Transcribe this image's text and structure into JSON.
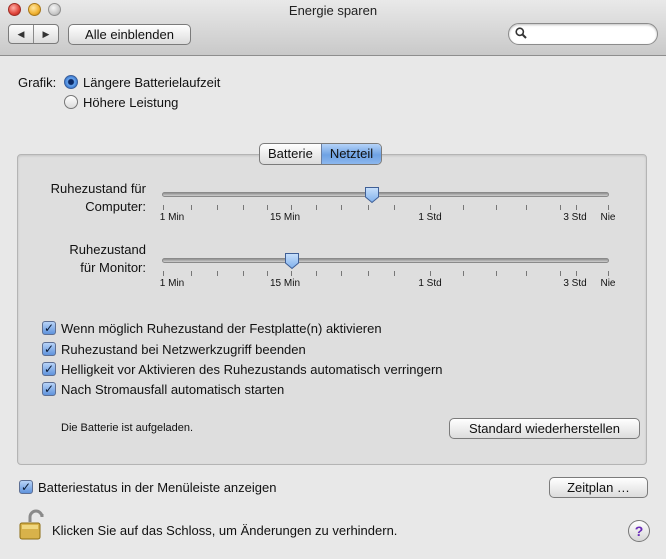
{
  "window": {
    "title": "Energie sparen"
  },
  "toolbar": {
    "back_glyph": "◀",
    "forward_glyph": "▶",
    "show_all_label": "Alle einblenden",
    "search_placeholder": "",
    "search_icon": "search-icon"
  },
  "graphics": {
    "label": "Grafik:",
    "options": [
      {
        "label": "Längere Batterielaufzeit",
        "selected": true
      },
      {
        "label": "Höhere Leistung",
        "selected": false
      }
    ]
  },
  "tabs": [
    {
      "label": "Batterie",
      "selected": false
    },
    {
      "label": "Netzteil",
      "selected": true
    }
  ],
  "sliders": [
    {
      "label_line1": "Ruhezustand für",
      "label_line2": "Computer:",
      "value_fraction": 0.47
    },
    {
      "label_line1": "Ruhezustand",
      "label_line2": "für Monitor:",
      "value_fraction": 0.29
    }
  ],
  "tick_labels": [
    "1 Min",
    "15 Min",
    "1 Std",
    "3 Std",
    "Nie"
  ],
  "checkboxes": [
    {
      "label": "Wenn möglich Ruhezustand der Festplatte(n) aktivieren",
      "checked": true
    },
    {
      "label": "Ruhezustand bei Netzwerkzugriff beenden",
      "checked": true
    },
    {
      "label": "Helligkeit vor Aktivieren des Ruhezustands automatisch verringern",
      "checked": true
    },
    {
      "label": "Nach Stromausfall automatisch starten",
      "checked": true
    }
  ],
  "battery_status": "Die Batterie ist aufgeladen.",
  "restore_defaults_label": "Standard wiederherstellen",
  "menu_battery": {
    "label": "Batteriestatus in der Menüleiste anzeigen",
    "checked": true
  },
  "schedule_label": "Zeitplan …",
  "lock_text": "Klicken Sie auf das Schloss, um Änderungen zu verhindern.",
  "help_glyph": "?",
  "colors": {
    "selected_blue": "#6ea2e4",
    "thumb_blue": "#7fb0ec"
  }
}
